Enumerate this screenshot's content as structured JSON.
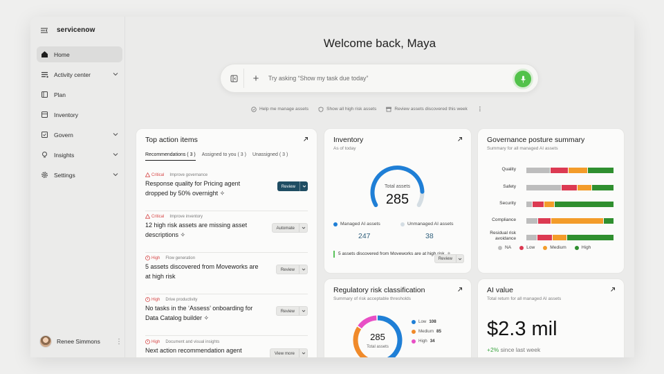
{
  "app": {
    "brand": "servicenow",
    "user_name": "Renee Simmons"
  },
  "sidebar": {
    "items": [
      {
        "label": "Home",
        "icon": "home-icon",
        "active": true,
        "expandable": false
      },
      {
        "label": "Activity center",
        "icon": "activity-icon",
        "active": false,
        "expandable": true
      },
      {
        "label": "Plan",
        "icon": "plan-icon",
        "active": false,
        "expandable": false
      },
      {
        "label": "Inventory",
        "icon": "inventory-icon",
        "active": false,
        "expandable": false
      },
      {
        "label": "Govern",
        "icon": "govern-icon",
        "active": false,
        "expandable": true
      },
      {
        "label": "Insights",
        "icon": "lightbulb-icon",
        "active": false,
        "expandable": true
      },
      {
        "label": "Settings",
        "icon": "gear-icon",
        "active": false,
        "expandable": true
      }
    ]
  },
  "header": {
    "welcome": "Welcome back, Maya"
  },
  "search": {
    "placeholder": "Try asking “Show my task due today”"
  },
  "suggestions": [
    {
      "label": "Help me manage assets",
      "icon": "shield-check-icon"
    },
    {
      "label": "Show all high risk assets",
      "icon": "shield-icon"
    },
    {
      "label": "Review assets discovered this week",
      "icon": "box-icon"
    }
  ],
  "top_actions": {
    "title": "Top action items",
    "tabs": [
      {
        "label": "Recommendations ( 3 )",
        "active": true
      },
      {
        "label": "Assigned to you ( 3 )",
        "active": false
      },
      {
        "label": "Unassigned  ( 3 )",
        "active": false
      }
    ],
    "items": [
      {
        "priority": "Critical",
        "category": "Improve governance",
        "text": "Response quality for Pricing agent dropped by 50% overnight ✧",
        "button": "Review",
        "style": "dark"
      },
      {
        "priority": "Critical",
        "category": "Improve inventory",
        "text": "12 high risk assets are missing asset descriptions ✧",
        "button": "Automate",
        "style": "light"
      },
      {
        "priority": "High",
        "category": "Flow generation",
        "text": "5 assets discovered from Moveworks are at high risk",
        "button": "Review",
        "style": "light"
      },
      {
        "priority": "High",
        "category": "Drive productivity",
        "text": "No tasks in the ‘Assess’ onboarding for Data Catalog builder ✧",
        "button": "Review",
        "style": "light"
      },
      {
        "priority": "High",
        "category": "Document and visual insights",
        "text": "Next action recommendation agent",
        "button": "View more",
        "style": "light"
      }
    ]
  },
  "inventory": {
    "title": "Inventory",
    "subtitle": "As of today",
    "total_label": "Total assets",
    "total": "285",
    "managed_label": "Managed AI assets",
    "managed": "247",
    "unmanaged_label": "Unmanaged AI assets",
    "unmanaged": "38",
    "discover_text": "5 assets discovered from Moveworks are at high risk. ✧",
    "discover_button": "Review",
    "colors": {
      "managed": "#1f7fd6",
      "unmanaged": "#d4dde3"
    }
  },
  "governance": {
    "title": "Governance posture summary",
    "subtitle": "Summary for all managed AI assets",
    "chart_data": {
      "type": "bar",
      "orientation": "horizontal-stacked",
      "categories": [
        "Quality",
        "Safety",
        "Security",
        "Compliance",
        "Residual risk avoidance"
      ],
      "series": [
        {
          "name": "NA",
          "color": "#bdbdbd",
          "values": [
            28,
            40,
            6,
            12,
            12
          ]
        },
        {
          "name": "Low",
          "color": "#dc3a52",
          "values": [
            20,
            17,
            12,
            14,
            16
          ]
        },
        {
          "name": "Medium",
          "color": "#f39c2a",
          "values": [
            22,
            16,
            11,
            58,
            16
          ]
        },
        {
          "name": "High",
          "color": "#2f8f2f",
          "values": [
            30,
            25,
            64,
            11,
            52
          ]
        }
      ],
      "legend": "bottom"
    }
  },
  "regulatory": {
    "title": "Regulatory risk classification",
    "subtitle": "Summary of risk acceptable thresholds",
    "total": "285",
    "total_label": "Total assets",
    "chart_data": {
      "type": "pie",
      "variant": "donut",
      "categories": [
        "Low",
        "Medium",
        "High"
      ],
      "values": [
        108,
        85,
        34
      ],
      "colors": [
        "#1f7fd6",
        "#f08a2a",
        "#e84fc5"
      ]
    }
  },
  "ai_value": {
    "title": "AI value",
    "subtitle": "Total return for all managed AI assets",
    "value": "$2.3 mil",
    "change": "+2%",
    "change_text": " since last week"
  }
}
